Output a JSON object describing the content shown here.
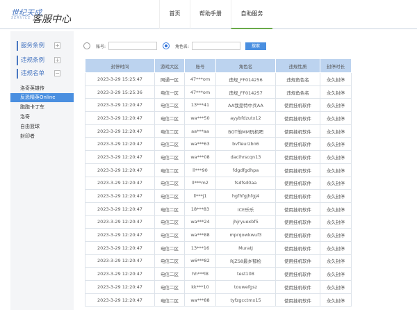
{
  "logo": {
    "line1": "世纪天成",
    "sub": "SERVICE",
    "line2": "客服中心"
  },
  "nav": [
    "首页",
    "帮助手册",
    "自助服务"
  ],
  "sidebar": {
    "sections": [
      "服务条例",
      "违规条例",
      "违规名单"
    ],
    "items": [
      "洛奇英雄传",
      "反恐精英Online",
      "跑跑卡丁车",
      "洛奇",
      "自由篮球",
      "封印者"
    ],
    "active": "反恐精英Online"
  },
  "search": {
    "account_label": "账号:",
    "role_label": "角色名:",
    "account_value": "",
    "role_value": "",
    "selected": "角色名",
    "button": "搜索"
  },
  "table": {
    "headers": [
      "封停时间",
      "游戏大区",
      "账号",
      "角色名",
      "违规性质",
      "封停时长"
    ],
    "rows": [
      [
        "2023-3-29 15:25:47",
        "网通一区",
        "47***om",
        "违规_FF014256",
        "违规角色名",
        "永久封停"
      ],
      [
        "2023-3-29 15:25:36",
        "电信一区",
        "47***om",
        "违规_FF014257",
        "违规角色名",
        "永久封停"
      ],
      [
        "2023-3-29 12:20:47",
        "电信二区",
        "13***41",
        "AA我是特中兵AA",
        "使用挂机软件",
        "永久封停"
      ],
      [
        "2023-3-29 12:20:47",
        "电信二区",
        "wa***50",
        "ayybfdzutx12",
        "使用挂机软件",
        "永久封停"
      ],
      [
        "2023-3-29 12:20:47",
        "电信二区",
        "aa***aa",
        "BOT他MM玩机吧",
        "使用挂机软件",
        "永久封停"
      ],
      [
        "2023-3-29 12:20:47",
        "电信二区",
        "wa***63",
        "bvfleurzbn6",
        "使用挂机软件",
        "永久封停"
      ],
      [
        "2023-3-29 12:20:47",
        "电信二区",
        "wa***08",
        "dacihrscqn13",
        "使用挂机软件",
        "永久封停"
      ],
      [
        "2023-3-29 12:20:47",
        "电信二区",
        "ll***90",
        "fdgdfgdhpa",
        "使用挂机软件",
        "永久封停"
      ],
      [
        "2023-3-29 12:20:47",
        "电信二区",
        "ll***m2",
        "fsdfsd0aa",
        "使用挂机软件",
        "永久封停"
      ],
      [
        "2023-3-29 12:20:47",
        "电信二区",
        "ll***j1",
        "hgfhfgjhfgj4",
        "使用挂机软件",
        "永久封停"
      ],
      [
        "2023-3-29 12:20:47",
        "电信二区",
        "18***83",
        "ICE乐乐",
        "使用挂机软件",
        "永久封停"
      ],
      [
        "2023-3-29 12:20:47",
        "电信二区",
        "wa***24",
        "jhjryuexbf5",
        "使用挂机软件",
        "永久封停"
      ],
      [
        "2023-3-29 12:20:47",
        "电信二区",
        "wa***88",
        "mprqowkwuf3",
        "使用挂机软件",
        "永久封停"
      ],
      [
        "2023-3-29 12:20:47",
        "电信二区",
        "13***16",
        "MuratJ",
        "使用挂机软件",
        "永久封停"
      ],
      [
        "2023-3-29 12:20:47",
        "电信二区",
        "w6***82",
        "RjZS8最乡郁检",
        "使用挂机软件",
        "永久封停"
      ],
      [
        "2023-3-29 12:20:47",
        "电信二区",
        "hh***l8",
        "test108",
        "使用挂机软件",
        "永久封停"
      ],
      [
        "2023-3-29 12:20:47",
        "电信二区",
        "kk***10",
        "touwefgsz",
        "使用挂机软件",
        "永久封停"
      ],
      [
        "2023-3-29 12:20:47",
        "电信二区",
        "wa***88",
        "tyfzgcctmx15",
        "使用挂机软件",
        "永久封停"
      ]
    ]
  },
  "colors": {
    "accent": "#4a8fe0",
    "header_bg": "#bcd3ef",
    "nav_active": "#6aaa4a"
  }
}
